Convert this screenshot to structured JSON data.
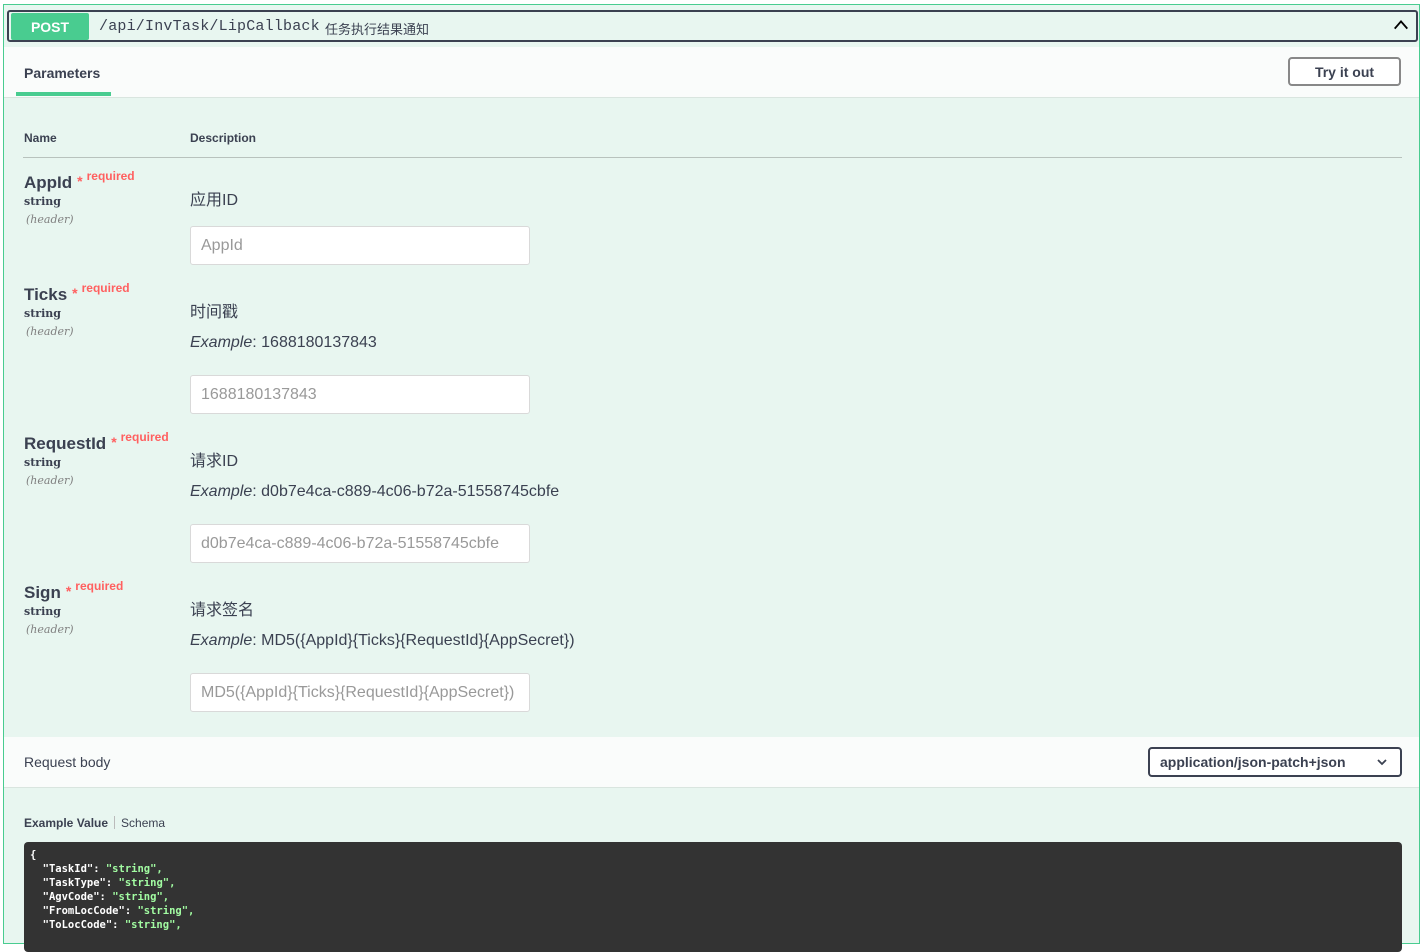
{
  "summary": {
    "method": "POST",
    "path": "/api/InvTask/LipCallback",
    "description": "任务执行结果通知"
  },
  "tabs": {
    "parameters": "Parameters",
    "try_it_out": "Try it out"
  },
  "columns": {
    "name": "Name",
    "description": "Description"
  },
  "required_label": "required",
  "required_star": "*",
  "params": [
    {
      "name": "AppId",
      "type": "string",
      "in": "(header)",
      "description": "应用ID",
      "example_label": "",
      "example_value": "",
      "placeholder": "AppId"
    },
    {
      "name": "Ticks",
      "type": "string",
      "in": "(header)",
      "description": "时间戳",
      "example_label": "Example",
      "example_value": ": 1688180137843",
      "placeholder": "1688180137843"
    },
    {
      "name": "RequestId",
      "type": "string",
      "in": "(header)",
      "description": "请求ID",
      "example_label": "Example",
      "example_value": ": d0b7e4ca-c889-4c06-b72a-51558745cbfe",
      "placeholder": "d0b7e4ca-c889-4c06-b72a-51558745cbfe"
    },
    {
      "name": "Sign",
      "type": "string",
      "in": "(header)",
      "description": "请求签名",
      "example_label": "Example",
      "example_value": ": MD5({AppId}{Ticks}{RequestId}{AppSecret})",
      "placeholder": "MD5({AppId}{Ticks}{RequestId}{AppSecret})"
    }
  ],
  "request_body": {
    "label": "Request body",
    "content_type": "application/json-patch+json"
  },
  "example": {
    "tab_example": "Example Value",
    "tab_schema": "Schema",
    "lines": [
      {
        "key": "{",
        "val": ""
      },
      {
        "key": "  \"TaskId\": ",
        "val": "\"string\","
      },
      {
        "key": "  \"TaskType\": ",
        "val": "\"string\","
      },
      {
        "key": "  \"AgvCode\": ",
        "val": "\"string\","
      },
      {
        "key": "  \"FromLocCode\": ",
        "val": "\"string\","
      },
      {
        "key": "  \"ToLocCode\": ",
        "val": "\"string\","
      }
    ]
  },
  "colors": {
    "post_green": "#49cc90",
    "block_bg": "#e8f6f0",
    "required_red": "#ff6060",
    "text": "#3b4151",
    "code_bg": "#333333",
    "code_string": "#a2fca2"
  },
  "icons": {
    "collapse": "chevron-up-icon",
    "select": "chevron-down-icon"
  }
}
